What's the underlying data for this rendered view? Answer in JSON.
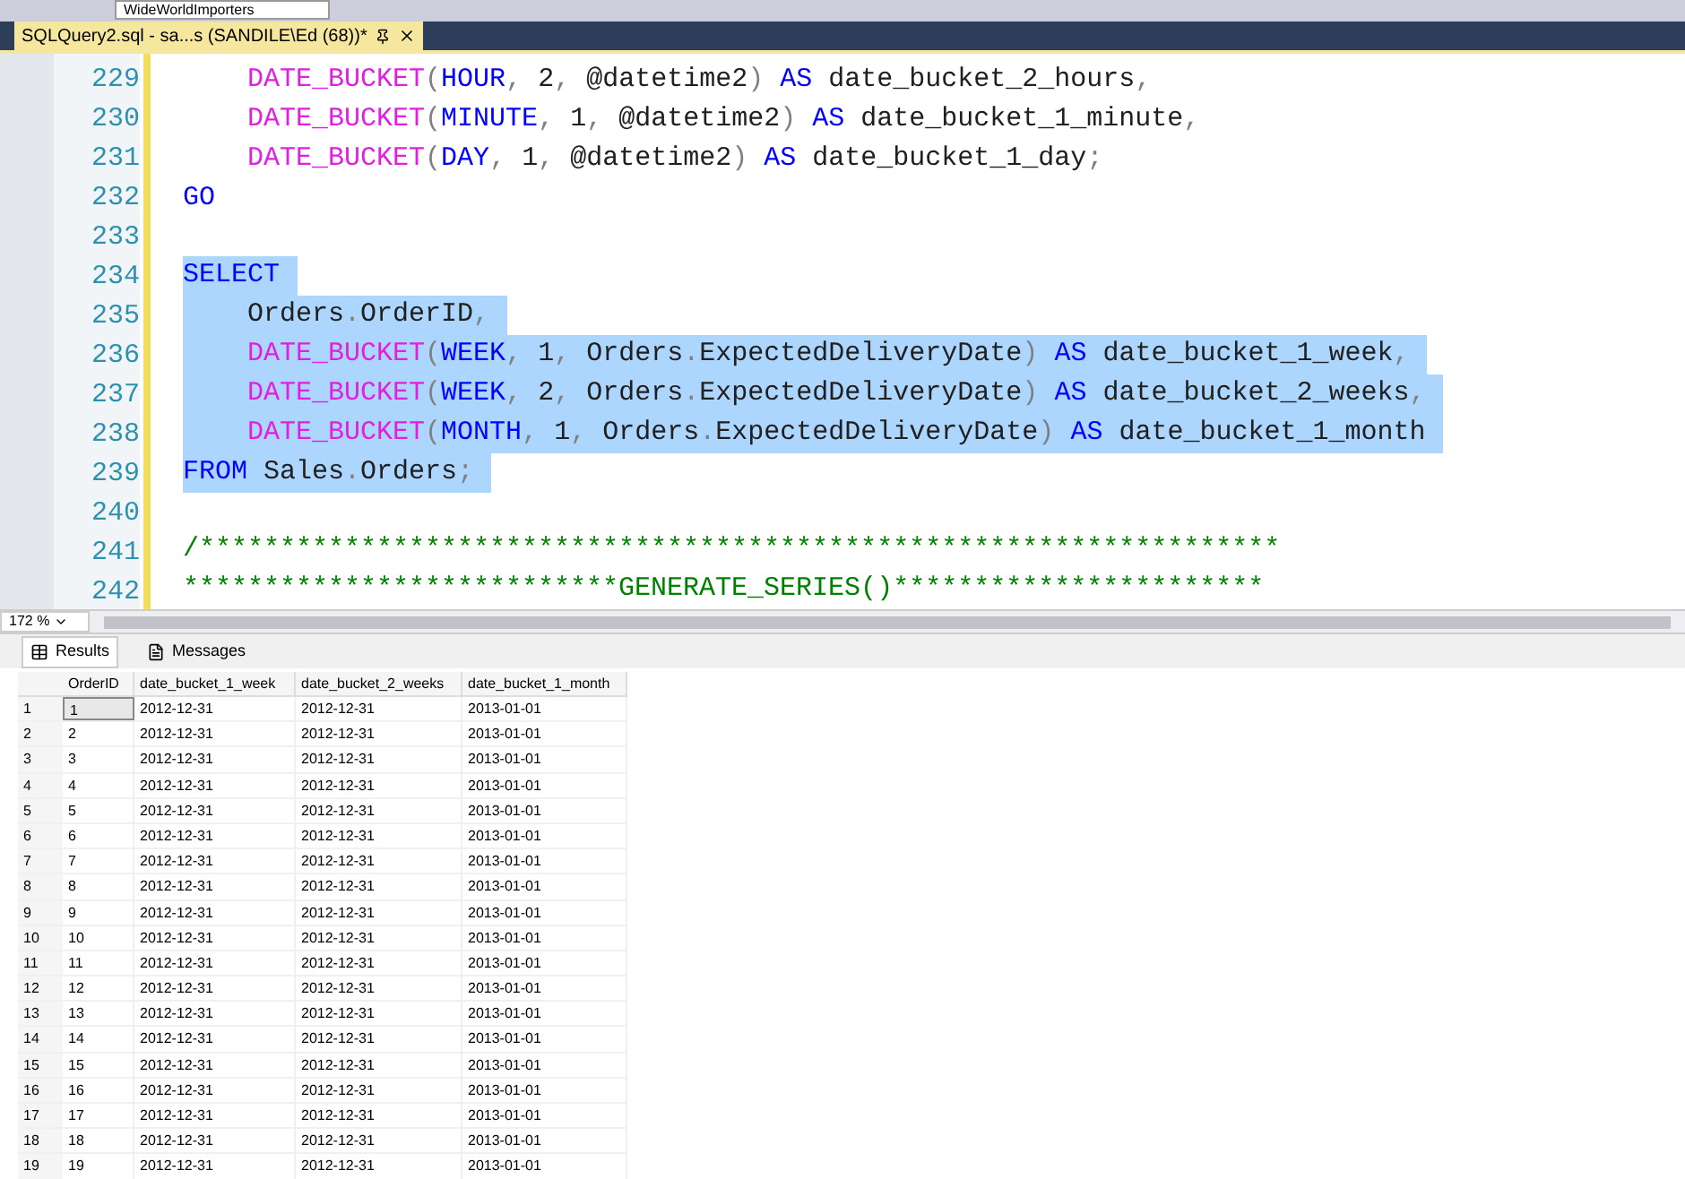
{
  "toolbar": {
    "database": "WideWorldImporters"
  },
  "tabs": [
    {
      "label": "SQLQuery2.sql - sa...s (SANDILE\\Ed (68))*",
      "selected": true
    }
  ],
  "editor": {
    "lines": [
      {
        "number": "229",
        "selected": false,
        "tokens": [
          {
            "kind": "func",
            "text": "    DATE_BUCKET"
          },
          {
            "kind": "punct",
            "text": "("
          },
          {
            "kind": "keyword",
            "text": "HOUR"
          },
          {
            "kind": "punct",
            "text": ", "
          },
          {
            "kind": "text",
            "text": "2"
          },
          {
            "kind": "punct",
            "text": ", "
          },
          {
            "kind": "text",
            "text": "@datetime2"
          },
          {
            "kind": "punct",
            "text": ") "
          },
          {
            "kind": "keyword",
            "text": "AS"
          },
          {
            "kind": "text",
            "text": " date_bucket_2_hours"
          },
          {
            "kind": "punct",
            "text": ","
          }
        ]
      },
      {
        "number": "230",
        "selected": false,
        "tokens": [
          {
            "kind": "func",
            "text": "    DATE_BUCKET"
          },
          {
            "kind": "punct",
            "text": "("
          },
          {
            "kind": "keyword",
            "text": "MINUTE"
          },
          {
            "kind": "punct",
            "text": ", "
          },
          {
            "kind": "text",
            "text": "1"
          },
          {
            "kind": "punct",
            "text": ", "
          },
          {
            "kind": "text",
            "text": "@datetime2"
          },
          {
            "kind": "punct",
            "text": ") "
          },
          {
            "kind": "keyword",
            "text": "AS"
          },
          {
            "kind": "text",
            "text": " date_bucket_1_minute"
          },
          {
            "kind": "punct",
            "text": ","
          }
        ]
      },
      {
        "number": "231",
        "selected": false,
        "tokens": [
          {
            "kind": "func",
            "text": "    DATE_BUCKET"
          },
          {
            "kind": "punct",
            "text": "("
          },
          {
            "kind": "keyword",
            "text": "DAY"
          },
          {
            "kind": "punct",
            "text": ", "
          },
          {
            "kind": "text",
            "text": "1"
          },
          {
            "kind": "punct",
            "text": ", "
          },
          {
            "kind": "text",
            "text": "@datetime2"
          },
          {
            "kind": "punct",
            "text": ") "
          },
          {
            "kind": "keyword",
            "text": "AS"
          },
          {
            "kind": "text",
            "text": " date_bucket_1_day"
          },
          {
            "kind": "punct",
            "text": ";"
          }
        ]
      },
      {
        "number": "232",
        "selected": false,
        "tokens": [
          {
            "kind": "keyword",
            "text": "GO"
          }
        ]
      },
      {
        "number": "233"
      },
      {
        "number": "234",
        "selected": true,
        "tokens": [
          {
            "kind": "keyword",
            "text": "SELECT"
          }
        ]
      },
      {
        "number": "235",
        "selected": true,
        "tokens": [
          {
            "kind": "text",
            "text": "    Orders"
          },
          {
            "kind": "punct",
            "text": "."
          },
          {
            "kind": "text",
            "text": "OrderID"
          },
          {
            "kind": "punct",
            "text": ","
          }
        ]
      },
      {
        "number": "236",
        "selected": true,
        "tokens": [
          {
            "kind": "func",
            "text": "    DATE_BUCKET"
          },
          {
            "kind": "punct",
            "text": "("
          },
          {
            "kind": "keyword",
            "text": "WEEK"
          },
          {
            "kind": "punct",
            "text": ", "
          },
          {
            "kind": "text",
            "text": "1"
          },
          {
            "kind": "punct",
            "text": ", "
          },
          {
            "kind": "text",
            "text": "Orders"
          },
          {
            "kind": "punct",
            "text": "."
          },
          {
            "kind": "text",
            "text": "ExpectedDeliveryDate"
          },
          {
            "kind": "punct",
            "text": ") "
          },
          {
            "kind": "keyword",
            "text": "AS"
          },
          {
            "kind": "text",
            "text": " date_bucket_1_week"
          },
          {
            "kind": "punct",
            "text": ","
          }
        ]
      },
      {
        "number": "237",
        "selected": true,
        "tokens": [
          {
            "kind": "func",
            "text": "    DATE_BUCKET"
          },
          {
            "kind": "punct",
            "text": "("
          },
          {
            "kind": "keyword",
            "text": "WEEK"
          },
          {
            "kind": "punct",
            "text": ", "
          },
          {
            "kind": "text",
            "text": "2"
          },
          {
            "kind": "punct",
            "text": ", "
          },
          {
            "kind": "text",
            "text": "Orders"
          },
          {
            "kind": "punct",
            "text": "."
          },
          {
            "kind": "text",
            "text": "ExpectedDeliveryDate"
          },
          {
            "kind": "punct",
            "text": ") "
          },
          {
            "kind": "keyword",
            "text": "AS"
          },
          {
            "kind": "text",
            "text": " date_bucket_2_weeks"
          },
          {
            "kind": "punct",
            "text": ","
          }
        ]
      },
      {
        "number": "238",
        "selected": true,
        "tokens": [
          {
            "kind": "func",
            "text": "    DATE_BUCKET"
          },
          {
            "kind": "punct",
            "text": "("
          },
          {
            "kind": "keyword",
            "text": "MONTH"
          },
          {
            "kind": "punct",
            "text": ", "
          },
          {
            "kind": "text",
            "text": "1"
          },
          {
            "kind": "punct",
            "text": ", "
          },
          {
            "kind": "text",
            "text": "Orders"
          },
          {
            "kind": "punct",
            "text": "."
          },
          {
            "kind": "text",
            "text": "ExpectedDeliveryDate"
          },
          {
            "kind": "punct",
            "text": ") "
          },
          {
            "kind": "keyword",
            "text": "AS"
          },
          {
            "kind": "text",
            "text": " date_bucket_1_month"
          }
        ]
      },
      {
        "number": "239",
        "selected": true,
        "tokens": [
          {
            "kind": "keyword",
            "text": "FROM"
          },
          {
            "kind": "text",
            "text": " Sales"
          },
          {
            "kind": "punct",
            "text": "."
          },
          {
            "kind": "text",
            "text": "Orders"
          },
          {
            "kind": "punct",
            "text": ";"
          }
        ]
      },
      {
        "number": "240"
      },
      {
        "number": "241",
        "selected": false,
        "tokens": [
          {
            "kind": "comment",
            "text": "/*******************************************************************"
          }
        ]
      },
      {
        "number": "242",
        "selected": false,
        "tokens": [
          {
            "kind": "comment",
            "text": "***************************GENERATE_SERIES()***********************"
          }
        ]
      }
    ]
  },
  "zoom": "172 %",
  "result_tabs": [
    {
      "label": "Results",
      "selected": true
    },
    {
      "label": "Messages",
      "selected": false
    }
  ],
  "grid": {
    "columns": [
      "OrderID",
      "date_bucket_1_week",
      "date_bucket_2_weeks",
      "date_bucket_1_month"
    ],
    "rows": [
      {
        "number": "1",
        "cells": [
          "1",
          "2012-12-31",
          "2012-12-31",
          "2013-01-01"
        ],
        "selected": true
      },
      {
        "number": "2",
        "cells": [
          "2",
          "2012-12-31",
          "2012-12-31",
          "2013-01-01"
        ],
        "selected": false
      },
      {
        "number": "3",
        "cells": [
          "3",
          "2012-12-31",
          "2012-12-31",
          "2013-01-01"
        ],
        "selected": false
      },
      {
        "number": "4",
        "cells": [
          "4",
          "2012-12-31",
          "2012-12-31",
          "2013-01-01"
        ],
        "selected": false
      },
      {
        "number": "5",
        "cells": [
          "5",
          "2012-12-31",
          "2012-12-31",
          "2013-01-01"
        ],
        "selected": false
      },
      {
        "number": "6",
        "cells": [
          "6",
          "2012-12-31",
          "2012-12-31",
          "2013-01-01"
        ],
        "selected": false
      },
      {
        "number": "7",
        "cells": [
          "7",
          "2012-12-31",
          "2012-12-31",
          "2013-01-01"
        ],
        "selected": false
      },
      {
        "number": "8",
        "cells": [
          "8",
          "2012-12-31",
          "2012-12-31",
          "2013-01-01"
        ],
        "selected": false
      },
      {
        "number": "9",
        "cells": [
          "9",
          "2012-12-31",
          "2012-12-31",
          "2013-01-01"
        ],
        "selected": false
      },
      {
        "number": "10",
        "cells": [
          "10",
          "2012-12-31",
          "2012-12-31",
          "2013-01-01"
        ],
        "selected": false
      },
      {
        "number": "11",
        "cells": [
          "11",
          "2012-12-31",
          "2012-12-31",
          "2013-01-01"
        ],
        "selected": false
      },
      {
        "number": "12",
        "cells": [
          "12",
          "2012-12-31",
          "2012-12-31",
          "2013-01-01"
        ],
        "selected": false
      },
      {
        "number": "13",
        "cells": [
          "13",
          "2012-12-31",
          "2012-12-31",
          "2013-01-01"
        ],
        "selected": false
      },
      {
        "number": "14",
        "cells": [
          "14",
          "2012-12-31",
          "2012-12-31",
          "2013-01-01"
        ],
        "selected": false
      },
      {
        "number": "15",
        "cells": [
          "15",
          "2012-12-31",
          "2012-12-31",
          "2013-01-01"
        ],
        "selected": false
      },
      {
        "number": "16",
        "cells": [
          "16",
          "2012-12-31",
          "2012-12-31",
          "2013-01-01"
        ],
        "selected": false
      },
      {
        "number": "17",
        "cells": [
          "17",
          "2012-12-31",
          "2012-12-31",
          "2013-01-01"
        ],
        "selected": false
      },
      {
        "number": "18",
        "cells": [
          "18",
          "2012-12-31",
          "2012-12-31",
          "2013-01-01"
        ],
        "selected": false
      },
      {
        "number": "19",
        "cells": [
          "19",
          "2012-12-31",
          "2012-12-31",
          "2013-01-01"
        ],
        "selected": false
      }
    ]
  }
}
